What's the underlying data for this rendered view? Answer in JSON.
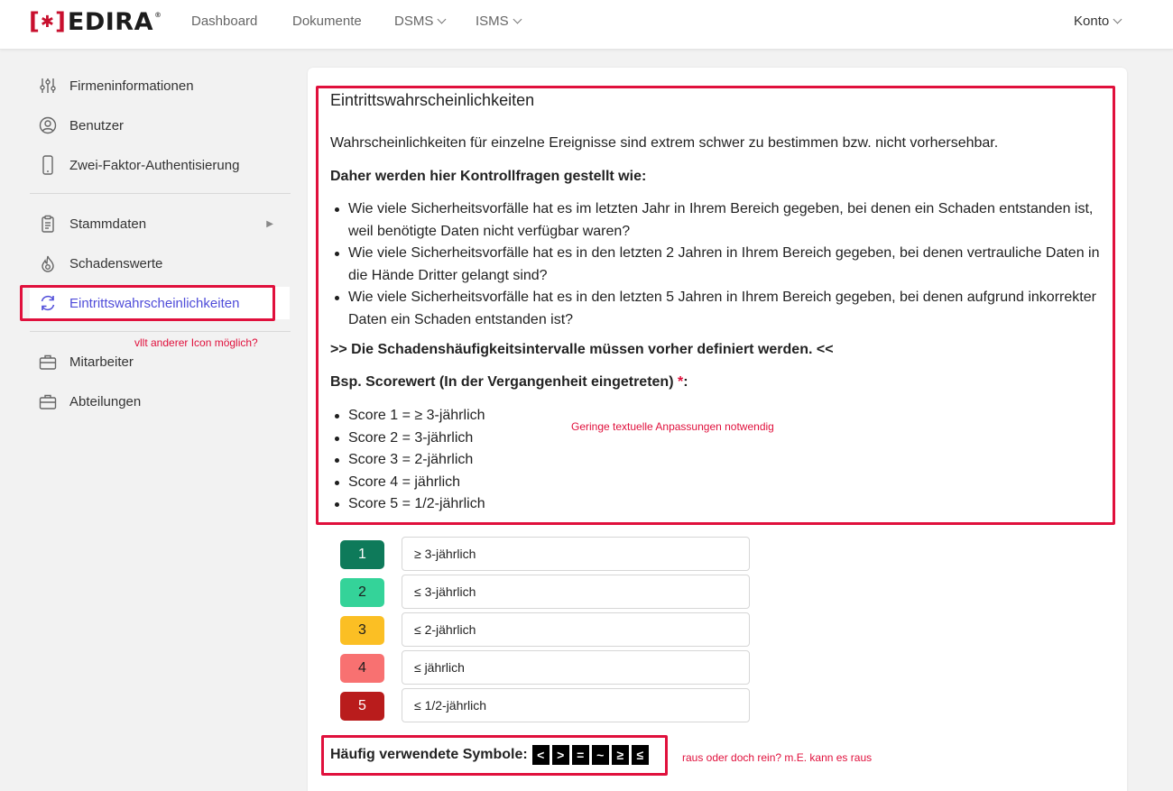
{
  "brand": {
    "bracket_left": "[",
    "star": "✱",
    "bracket_right": "]",
    "name": "EDIRA",
    "reg": "®"
  },
  "nav": {
    "items": [
      "Dashboard",
      "Dokumente",
      "DSMS",
      "ISMS"
    ],
    "account": "Konto"
  },
  "sidebar": {
    "items": [
      {
        "label": "Firmeninformationen",
        "icon": "sliders-icon"
      },
      {
        "label": "Benutzer",
        "icon": "user-circle-icon"
      },
      {
        "label": "Zwei-Faktor-Authentisierung",
        "icon": "phone-icon"
      },
      {
        "label": "Stammdaten",
        "icon": "clipboard-icon"
      },
      {
        "label": "Schadenswerte",
        "icon": "flame-icon"
      },
      {
        "label": "Eintrittswahrscheinlichkeiten",
        "icon": "refresh-icon"
      },
      {
        "label": "Mitarbeiter",
        "icon": "briefcase-icon"
      },
      {
        "label": "Abteilungen",
        "icon": "briefcase-icon"
      }
    ],
    "active_color": "#4f4cd9"
  },
  "annotations": {
    "icon_note": "vllt anderer Icon möglich?",
    "text_note": "Geringe textuelle Anpassungen notwendig",
    "symbols_note": "raus oder doch rein? m.E. kann es raus",
    "highlight_color": "#e0103c"
  },
  "main": {
    "title": "Eintrittswahrscheinlichkeiten",
    "intro": "Wahrscheinlichkeiten für einzelne Ereignisse sind extrem schwer zu bestimmen bzw. nicht vorhersehbar.",
    "questions_heading": "Daher werden hier Kontrollfragen gestellt wie:",
    "questions": [
      "Wie viele Sicherheitsvorfälle hat es im letzten Jahr in Ihrem Bereich gegeben, bei denen ein Schaden entstanden ist, weil benötigte Daten nicht verfügbar waren?",
      "Wie viele Sicherheitsvorfälle hat es in den letzten 2 Jahren in Ihrem Bereich gegeben, bei denen vertrauliche Daten in die Hände Dritter gelangt sind?",
      "Wie viele Sicherheitsvorfälle hat es in den letzten 5 Jahren in Ihrem Bereich gegeben, bei denen aufgrund inkorrekter Daten ein Schaden entstanden ist?"
    ],
    "interval_note": ">> Die Schadenshäufigkeitsintervalle müssen vorher definiert werden. <<",
    "example_heading": "Bsp. Scorewert (In der Vergangenheit eingetreten) ",
    "example_required": "*",
    "example_colon": ":",
    "scores": [
      "Score 1 = ≥ 3-jährlich",
      "Score 2 = 3-jährlich",
      "Score 3 = 2-jährlich",
      "Score 4 = jährlich",
      "Score 5 = 1/2-jährlich"
    ]
  },
  "score_rows": [
    {
      "level": "1",
      "value": "≥ 3-jährlich",
      "color": "#0e7a5a",
      "text_color": "#ffffff"
    },
    {
      "level": "2",
      "value": "≤ 3-jährlich",
      "color": "#34d399",
      "text_color": "#1e1e1e"
    },
    {
      "level": "3",
      "value": "≤ 2-jährlich",
      "color": "#fbbf24",
      "text_color": "#1e1e1e"
    },
    {
      "level": "4",
      "value": "≤ jährlich",
      "color": "#f87171",
      "text_color": "#1e1e1e"
    },
    {
      "level": "5",
      "value": "≤ 1/2-jährlich",
      "color": "#b91c1c",
      "text_color": "#ffffff"
    }
  ],
  "symbols": {
    "label": "Häufig verwendete Symbole:",
    "items": [
      "<",
      ">",
      "=",
      "~",
      "≥",
      "≤"
    ]
  }
}
